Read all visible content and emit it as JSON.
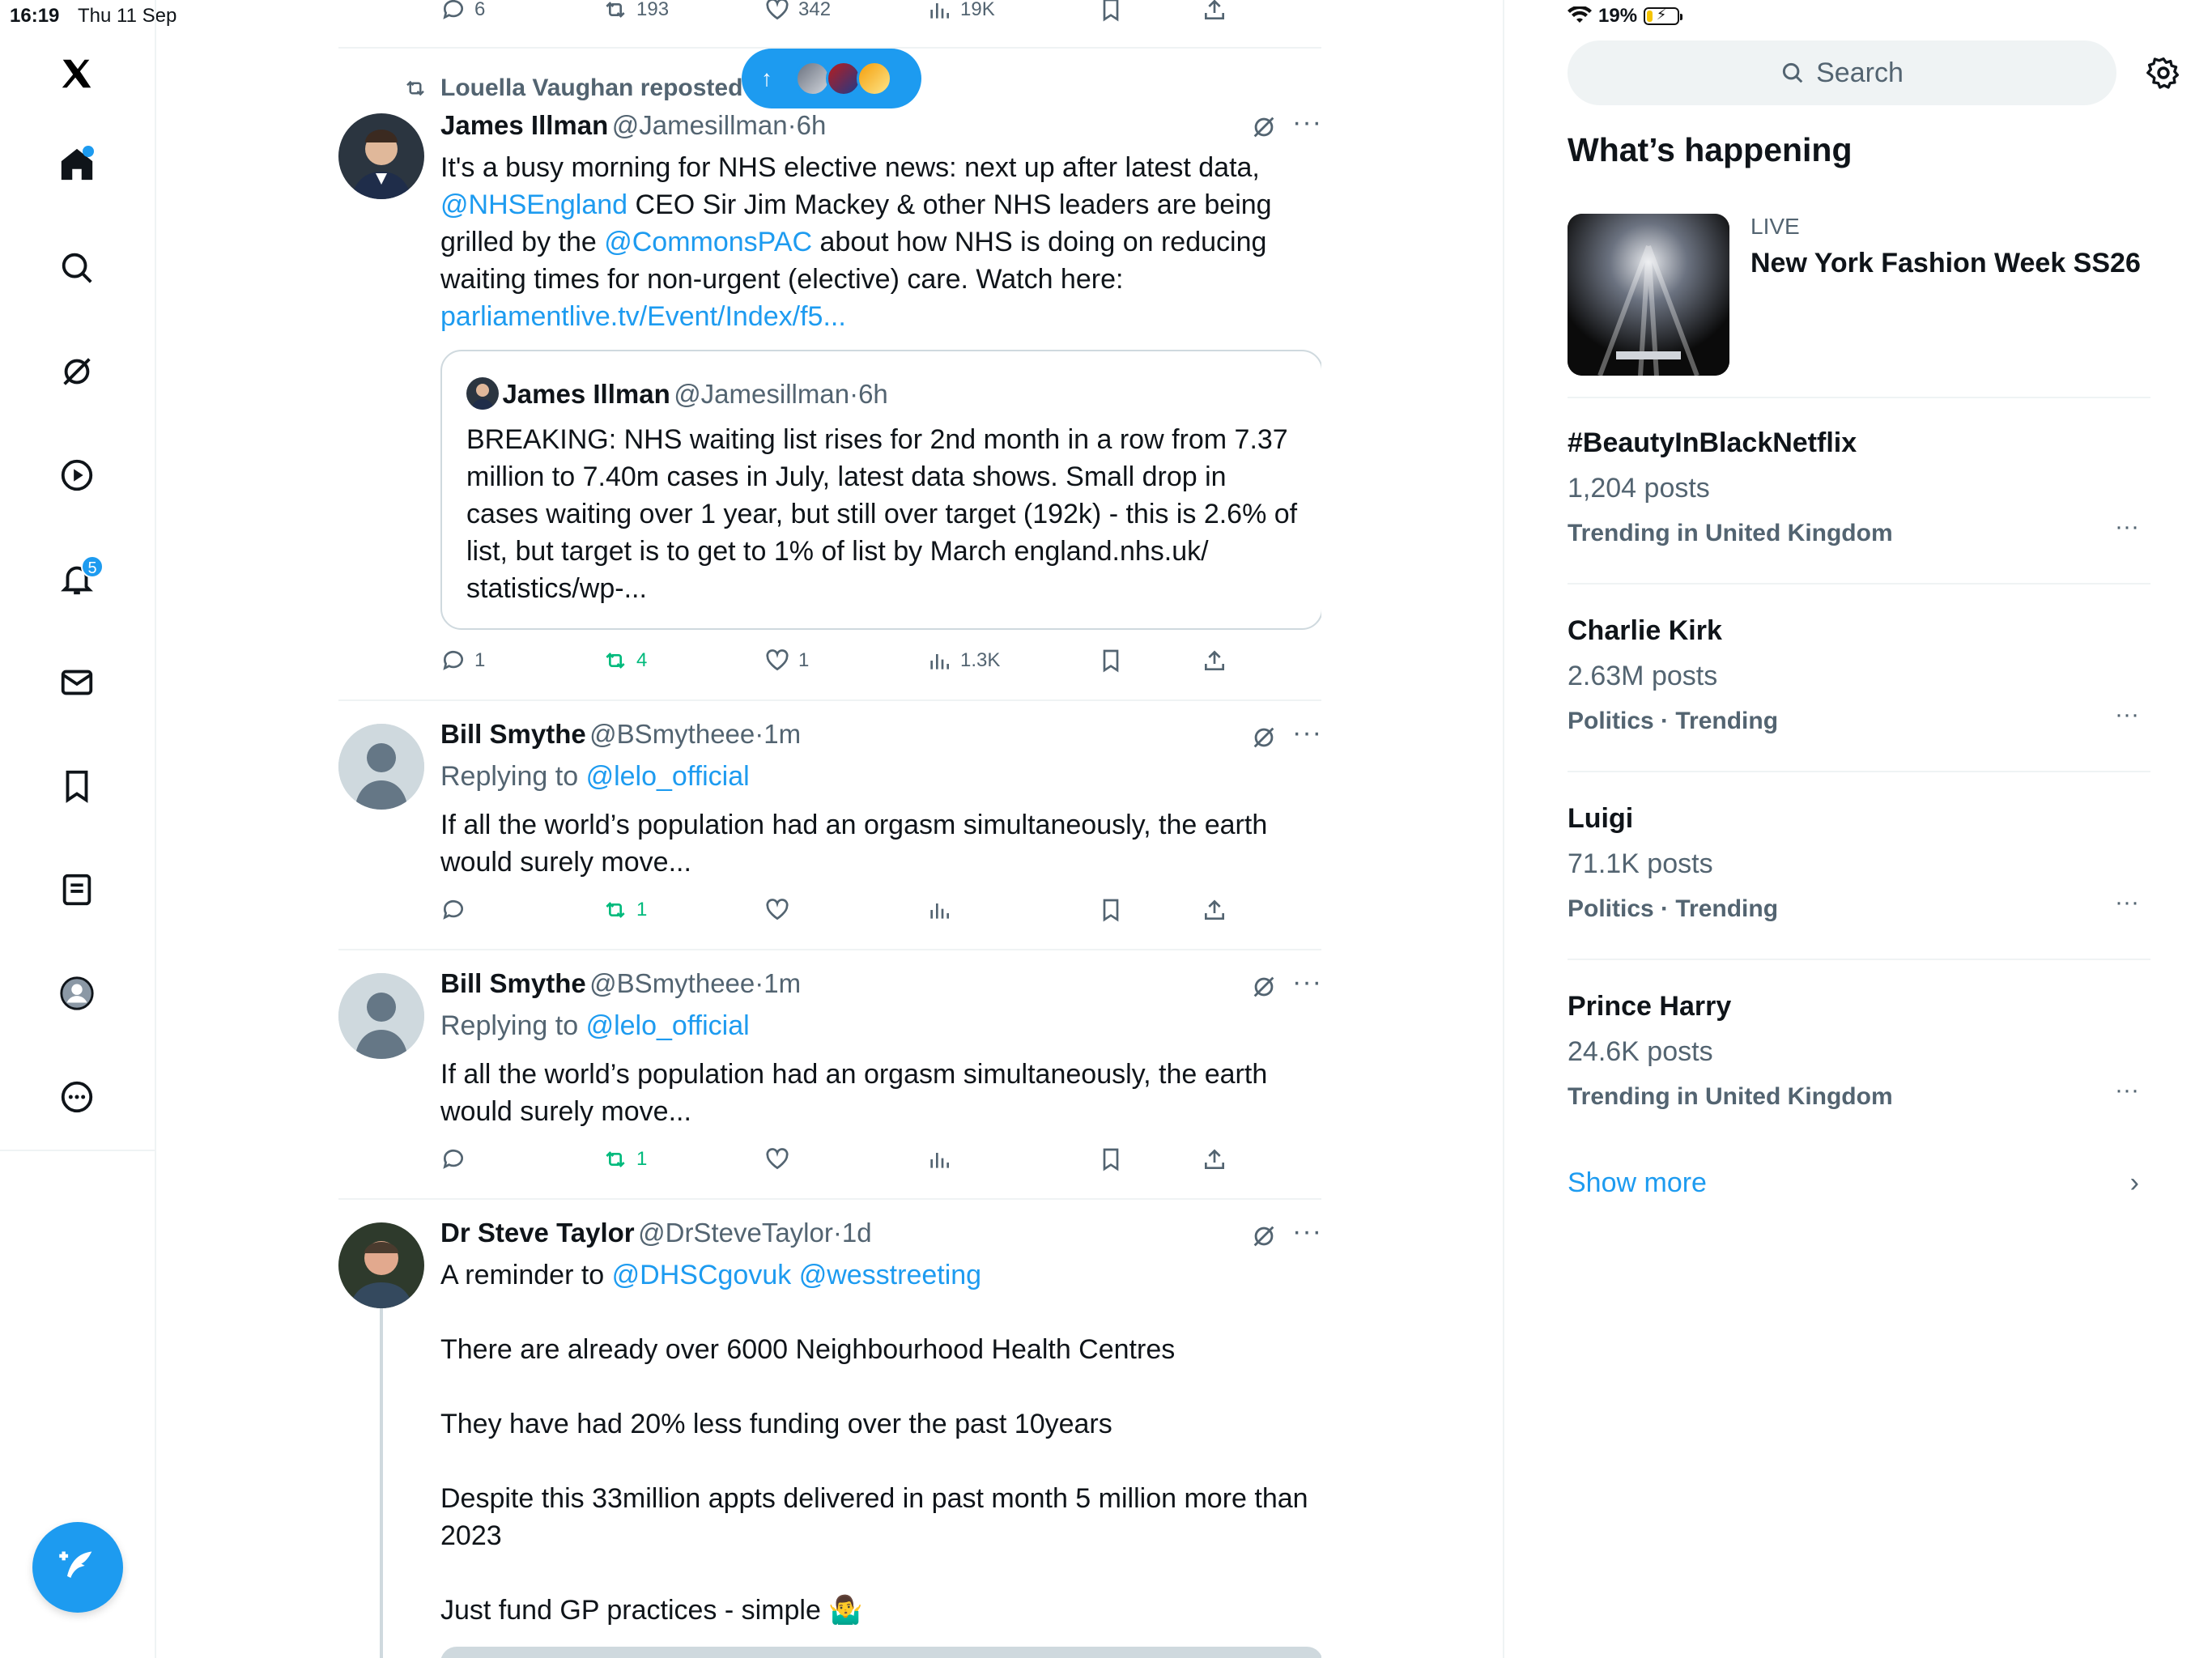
{
  "status": {
    "time": "16:19",
    "date": "Thu 11 Sep",
    "battery": "19%",
    "battery_level": 0.19
  },
  "nav": {
    "notifications_badge": "5"
  },
  "top_actions": {
    "replies": "6",
    "reposts": "193",
    "likes": "342",
    "views": "19K"
  },
  "repost": {
    "by": "Louella Vaughan reposted"
  },
  "tweet1": {
    "name": "James Illman",
    "handle": "@Jamesillman",
    "sep": "·",
    "time": "6h",
    "t1": "It's a busy morning for NHS elective news: next up after latest data,",
    "mention1": "@NHSEngland",
    "t2": " CEO Sir Jim Mackey & other NHS leaders are being grilled by the ",
    "mention2": "@CommonsPAC",
    "t3": " about how NHS is doing on reducing waiting times for non-urgent (elective) care. Watch here:",
    "url": "parliamentlive.tv/Event/Index/f5...",
    "quote": {
      "name": "James Illman",
      "handle": "@Jamesillman",
      "sep": "·",
      "time": "6h",
      "text": "BREAKING: NHS waiting list rises for 2nd month in a row from 7.37 million  to 7.40m cases in July, latest data shows. Small drop in cases waiting over 1 year, but still over target  (192k) - this is 2.6% of list, but target is to get to 1% of list by March england.nhs.uk/ statistics/wp-..."
    },
    "replies": "1",
    "reposts": "4",
    "likes": "1",
    "views": "1.3K"
  },
  "tweet2": {
    "name": "Bill Smythe",
    "handle": "@BSmytheee",
    "sep": "·",
    "time": "1m",
    "replying": "Replying to",
    "reply_to": "@lelo_official",
    "text": "If all the world’s population had an orgasm simultaneously, the earth would surely move...",
    "reposts": "1"
  },
  "tweet3": {
    "name": "Bill Smythe",
    "handle": "@BSmytheee",
    "sep": "·",
    "time": "1m",
    "replying": "Replying to",
    "reply_to": "@lelo_official",
    "text": "If all the world’s population had an orgasm simultaneously, the earth would surely move...",
    "reposts": "1"
  },
  "tweet4": {
    "name": "Dr Steve Taylor",
    "handle": "@DrSteveTaylor",
    "sep": "·",
    "time": "1d",
    "lead": "A reminder to ",
    "m1": "@DHSCgovuk",
    "m2": "@wesstreeting",
    "p1": "There are already over 6000 Neighbourhood Health Centres",
    "p2": "They have had 20% less funding over the past 10years",
    "p3": "Despite this 33million appts delivered in past month 5 million more than 2023",
    "p4": "Just fund GP practices - simple 🤷‍♂️"
  },
  "sidebar": {
    "search_placeholder": "Search",
    "title": "What’s happening",
    "live": {
      "label": "LIVE",
      "title": "New York Fashion Week SS26"
    },
    "trends": [
      {
        "name": "#BeautyInBlackNetflix",
        "count": "1,204 posts",
        "context": "Trending in United Kingdom"
      },
      {
        "name": "Charlie Kirk",
        "count": "2.63M posts",
        "context": "Politics · Trending"
      },
      {
        "name": "Luigi",
        "count": "71.1K posts",
        "context": "Politics · Trending"
      },
      {
        "name": "Prince Harry",
        "count": "24.6K posts",
        "context": "Trending in United Kingdom"
      }
    ],
    "show_more": "Show more"
  }
}
